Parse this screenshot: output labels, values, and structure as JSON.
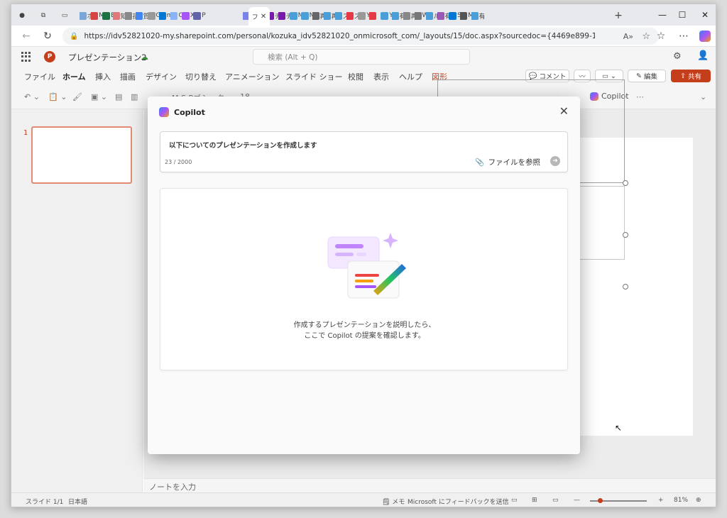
{
  "browser": {
    "tabs": [
      "ホ",
      "M",
      "E",
      "知",
      "孫",
      "質",
      "G",
      "m",
      "O",
      "X",
      "P",
      "フ",
      "ネ",
      "チ",
      "チ",
      "N",
      "N",
      "再",
      "再",
      "ス",
      "ス",
      "Y",
      "「",
      "Y",
      "有",
      "再",
      "W",
      "ル",
      "有",
      "S",
      "M",
      "有"
    ],
    "active_tab_label": "フ",
    "url": "https://idv52821020-my.sharepoint.com/personal/kozuka_idv52821020_onmicrosoft_com/_layouts/15/doc.aspx?sourcedoc={4469e899-13a5-4bda-9bbb-5a2f367..."
  },
  "app": {
    "doc_name": "プレゼンテーション2",
    "search_placeholder": "検索 (Alt + Q)"
  },
  "ribbon": {
    "tabs": [
      "ファイル",
      "ホーム",
      "挿入",
      "描画",
      "デザイン",
      "切り替え",
      "アニメーション",
      "スライド ショー",
      "校閲",
      "表示",
      "ヘルプ",
      "図形"
    ],
    "comment": "コメント",
    "edit": "編集",
    "share": "共有",
    "font_name": "M S Pゴシック",
    "font_size": "18",
    "copilot": "Copilot"
  },
  "thumbs": {
    "slide_number": "1"
  },
  "notes": {
    "placeholder": "ノートを入力"
  },
  "status": {
    "slide": "スライド 1/1",
    "lang": "日本語",
    "memo": "メモ",
    "feedback": "Microsoft にフィードバックを送信",
    "zoom": "81%"
  },
  "modal": {
    "title": "Copilot",
    "prompt_text": "以下についてのプレゼンテーションを作成します",
    "char_count": "23 / 2000",
    "file_ref": "ファイルを参照",
    "desc_line1": "作成するプレゼンテーションを説明したら、",
    "desc_line2": "ここで Copilot の提案を確認します。"
  },
  "colors": {
    "accent": "#c43e1c",
    "thumb_border": "#e28b74"
  }
}
